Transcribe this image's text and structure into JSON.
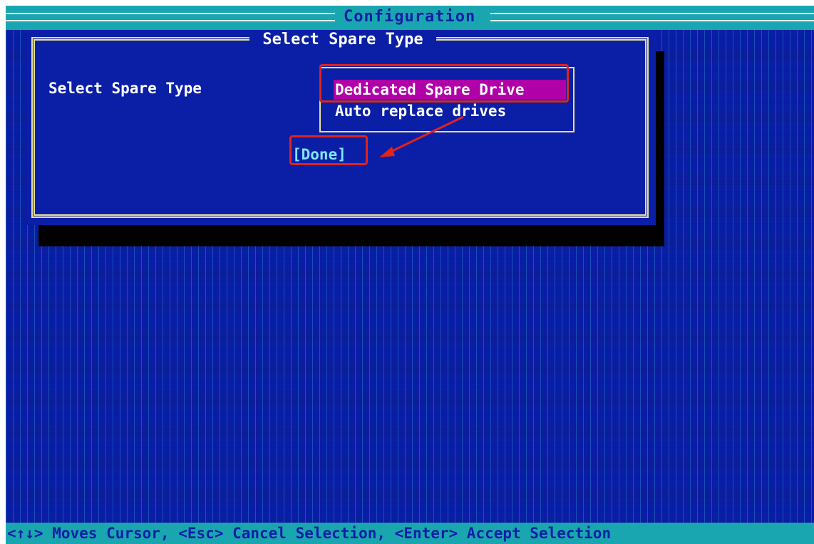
{
  "header": {
    "title": "Configuration"
  },
  "dialog": {
    "title": "Select Spare Type",
    "field_label": "Select Spare Type",
    "options": [
      {
        "label": "Dedicated Spare Drive",
        "selected": true
      },
      {
        "label": "Auto replace drives",
        "selected": false
      }
    ],
    "done_label": "[Done]"
  },
  "status_bar": {
    "text": "<↑↓> Moves Cursor, <Esc> Cancel Selection, <Enter> Accept Selection"
  },
  "colors": {
    "background": "#0a1fa6",
    "bar": "#1aa6b0",
    "selection": "#b000a8",
    "frame": "#e8e0a0",
    "annotation": "#e0231c",
    "done_text": "#7fe6ff"
  }
}
